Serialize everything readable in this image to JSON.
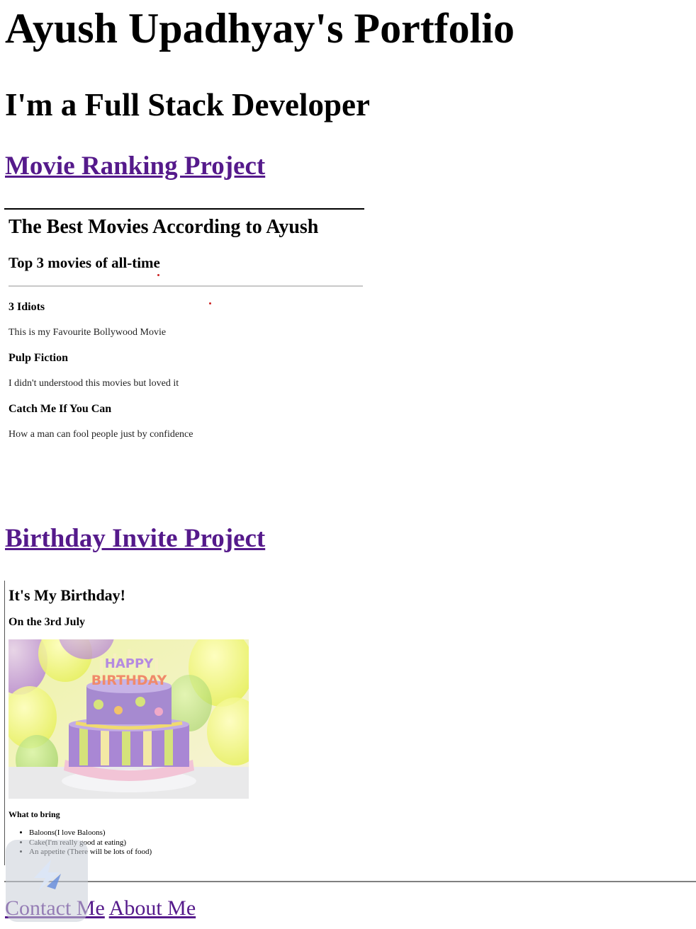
{
  "page": {
    "title": "Ayush Upadhyay's Portfolio",
    "subtitle": "I'm a Full Stack Developer"
  },
  "projects": {
    "movie_link": "Movie Ranking Project",
    "birthday_link": "Birthday Invite Project"
  },
  "movie_frame": {
    "heading": "The Best Movies According to Ayush",
    "subheading": "Top 3 movies of all-time",
    "movies": [
      {
        "title": "3 Idiots",
        "description": "This is my Favourite Bollywood Movie"
      },
      {
        "title": "Pulp Fiction",
        "description": "I didn't understood this movies but loved it"
      },
      {
        "title": "Catch Me If You Can",
        "description": "How a man can fool people just by confidence"
      }
    ]
  },
  "birthday_frame": {
    "heading": "It's My Birthday!",
    "date": "On the 3rd July",
    "cake_text_top": "HAPPY",
    "cake_text_bottom": "BIRTHDAY",
    "bring_heading": "What to bring",
    "items": [
      "Baloons(I love Baloons)",
      "Cake(I'm really good at eating)",
      "An appetite (There will be lots of food)"
    ]
  },
  "footer": {
    "contact_label": "Contact Me",
    "about_label": "About Me"
  },
  "colors": {
    "link": "#551a8b",
    "text": "#000000",
    "background": "#ffffff"
  },
  "icons": {
    "overlay": "app-logo-icon"
  }
}
